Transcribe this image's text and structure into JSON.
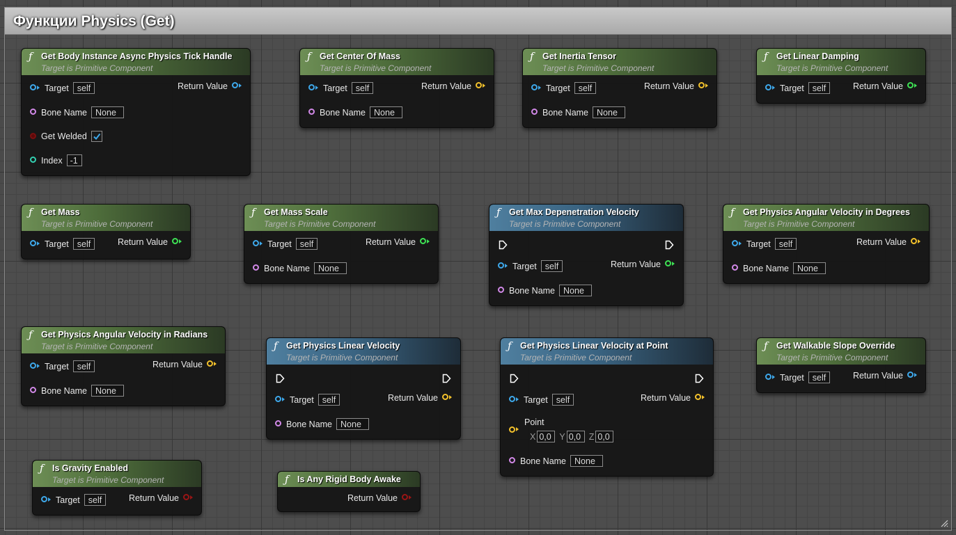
{
  "comment": {
    "title": "Функции Physics (Get)"
  },
  "nodes": {
    "get_body_instance_async": {
      "title": "Get Body Instance Async Physics Tick Handle",
      "subtitle": "Target is Primitive Component",
      "target_label": "Target",
      "target_value": "self",
      "bone_label": "Bone Name",
      "bone_value": "None",
      "welded_label": "Get Welded",
      "welded_checked": true,
      "index_label": "Index",
      "index_value": "-1",
      "return_label": "Return Value"
    },
    "get_center_of_mass": {
      "title": "Get Center Of Mass",
      "subtitle": "Target is Primitive Component",
      "target_label": "Target",
      "target_value": "self",
      "bone_label": "Bone Name",
      "bone_value": "None",
      "return_label": "Return Value"
    },
    "get_inertia_tensor": {
      "title": "Get Inertia Tensor",
      "subtitle": "Target is Primitive Component",
      "target_label": "Target",
      "target_value": "self",
      "bone_label": "Bone Name",
      "bone_value": "None",
      "return_label": "Return Value"
    },
    "get_linear_damping": {
      "title": "Get Linear Damping",
      "subtitle": "Target is Primitive Component",
      "target_label": "Target",
      "target_value": "self",
      "return_label": "Return Value"
    },
    "get_mass": {
      "title": "Get Mass",
      "subtitle": "Target is Primitive Component",
      "target_label": "Target",
      "target_value": "self",
      "return_label": "Return Value"
    },
    "get_mass_scale": {
      "title": "Get Mass Scale",
      "subtitle": "Target is Primitive Component",
      "target_label": "Target",
      "target_value": "self",
      "bone_label": "Bone Name",
      "bone_value": "None",
      "return_label": "Return Value"
    },
    "get_max_depenetration_velocity": {
      "title": "Get Max Depenetration Velocity",
      "subtitle": "Target is Primitive Component",
      "target_label": "Target",
      "target_value": "self",
      "bone_label": "Bone Name",
      "bone_value": "None",
      "return_label": "Return Value"
    },
    "get_angular_velocity_degrees": {
      "title": "Get Physics Angular Velocity in Degrees",
      "subtitle": "Target is Primitive Component",
      "target_label": "Target",
      "target_value": "self",
      "bone_label": "Bone Name",
      "bone_value": "None",
      "return_label": "Return Value"
    },
    "get_angular_velocity_radians": {
      "title": "Get Physics Angular Velocity in Radians",
      "subtitle": "Target is Primitive Component",
      "target_label": "Target",
      "target_value": "self",
      "bone_label": "Bone Name",
      "bone_value": "None",
      "return_label": "Return Value"
    },
    "get_linear_velocity": {
      "title": "Get Physics Linear Velocity",
      "subtitle": "Target is Primitive Component",
      "target_label": "Target",
      "target_value": "self",
      "bone_label": "Bone Name",
      "bone_value": "None",
      "return_label": "Return Value"
    },
    "get_linear_velocity_at_point": {
      "title": "Get Physics Linear Velocity at Point",
      "subtitle": "Target is Primitive Component",
      "target_label": "Target",
      "target_value": "self",
      "point_label": "Point",
      "x_label": "X",
      "x_value": "0,0",
      "y_label": "Y",
      "y_value": "0,0",
      "z_label": "Z",
      "z_value": "0,0",
      "bone_label": "Bone Name",
      "bone_value": "None",
      "return_label": "Return Value"
    },
    "get_walkable_slope_override": {
      "title": "Get Walkable Slope Override",
      "subtitle": "Target is Primitive Component",
      "target_label": "Target",
      "target_value": "self",
      "return_label": "Return Value"
    },
    "is_gravity_enabled": {
      "title": "Is Gravity Enabled",
      "subtitle": "Target is Primitive Component",
      "target_label": "Target",
      "target_value": "self",
      "return_label": "Return Value"
    },
    "is_any_rigid_body_awake": {
      "title": "Is Any Rigid Body Awake",
      "return_label": "Return Value"
    }
  }
}
